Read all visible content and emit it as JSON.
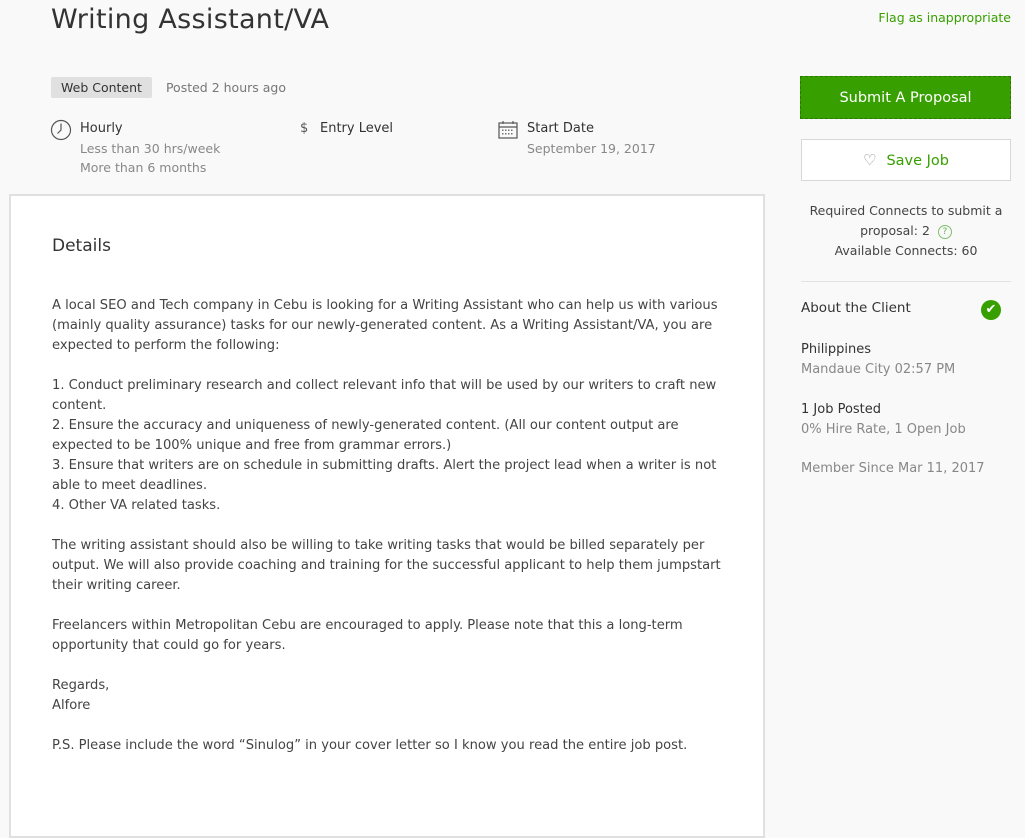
{
  "job": {
    "title": "Writing Assistant/VA",
    "flag_link": "Flag as inappropriate",
    "category": "Web Content",
    "posted": "Posted 2 hours ago",
    "facets": {
      "hourly": {
        "icon": "clock-icon",
        "label": "Hourly",
        "lines": [
          "Less than 30 hrs/week",
          "More than 6 months"
        ]
      },
      "level": {
        "icon": "dollar-icon",
        "icon_glyph": "$",
        "label": "Entry Level"
      },
      "start": {
        "icon": "calendar-icon",
        "label": "Start Date",
        "value": "September 19, 2017"
      }
    }
  },
  "details": {
    "heading": "Details",
    "paragraphs": [
      "A local SEO and Tech company in Cebu is looking for a Writing Assistant who can help us with various (mainly quality assurance) tasks for our newly-generated content. As a Writing Assistant/VA, you are expected to perform the following:",
      "1. Conduct preliminary research and collect relevant info that will be used by our writers to craft new content.",
      "2. Ensure the accuracy and uniqueness of newly-generated content. (All our content output are expected to be 100% unique and free from grammar errors.)",
      "3. Ensure that writers are on schedule in submitting drafts. Alert the project lead when a writer is not able to meet deadlines.",
      "4. Other VA related tasks.",
      "The writing assistant should also be willing to take writing tasks that would be billed separately per output. We will also provide coaching and training for the successful applicant to help them jumpstart their writing career.",
      "Freelancers within Metropolitan Cebu are encouraged to apply. Please note that this a long-term opportunity that could go for years.",
      "Regards,",
      "Alfore",
      "P.S. Please include the word “Sinulog” in your cover letter so I know you read the entire job post."
    ]
  },
  "sidebar": {
    "submit_label": "Submit A Proposal",
    "save_label": "Save Job",
    "save_icon": "♡",
    "connects_required": "Required Connects to submit a proposal: 2",
    "connects_help": "?",
    "connects_available": "Available Connects: 60",
    "about_client": "About the Client",
    "verified_glyph": "✔",
    "country": "Philippines",
    "city_time": "Mandaue City 02:57 PM",
    "jobs_posted": "1 Job Posted",
    "hire_stats": "0% Hire Rate, 1 Open Job",
    "member_since": "Member Since Mar 11, 2017"
  },
  "colors": {
    "accent": "#37a000",
    "background": "#f9f9f9"
  }
}
